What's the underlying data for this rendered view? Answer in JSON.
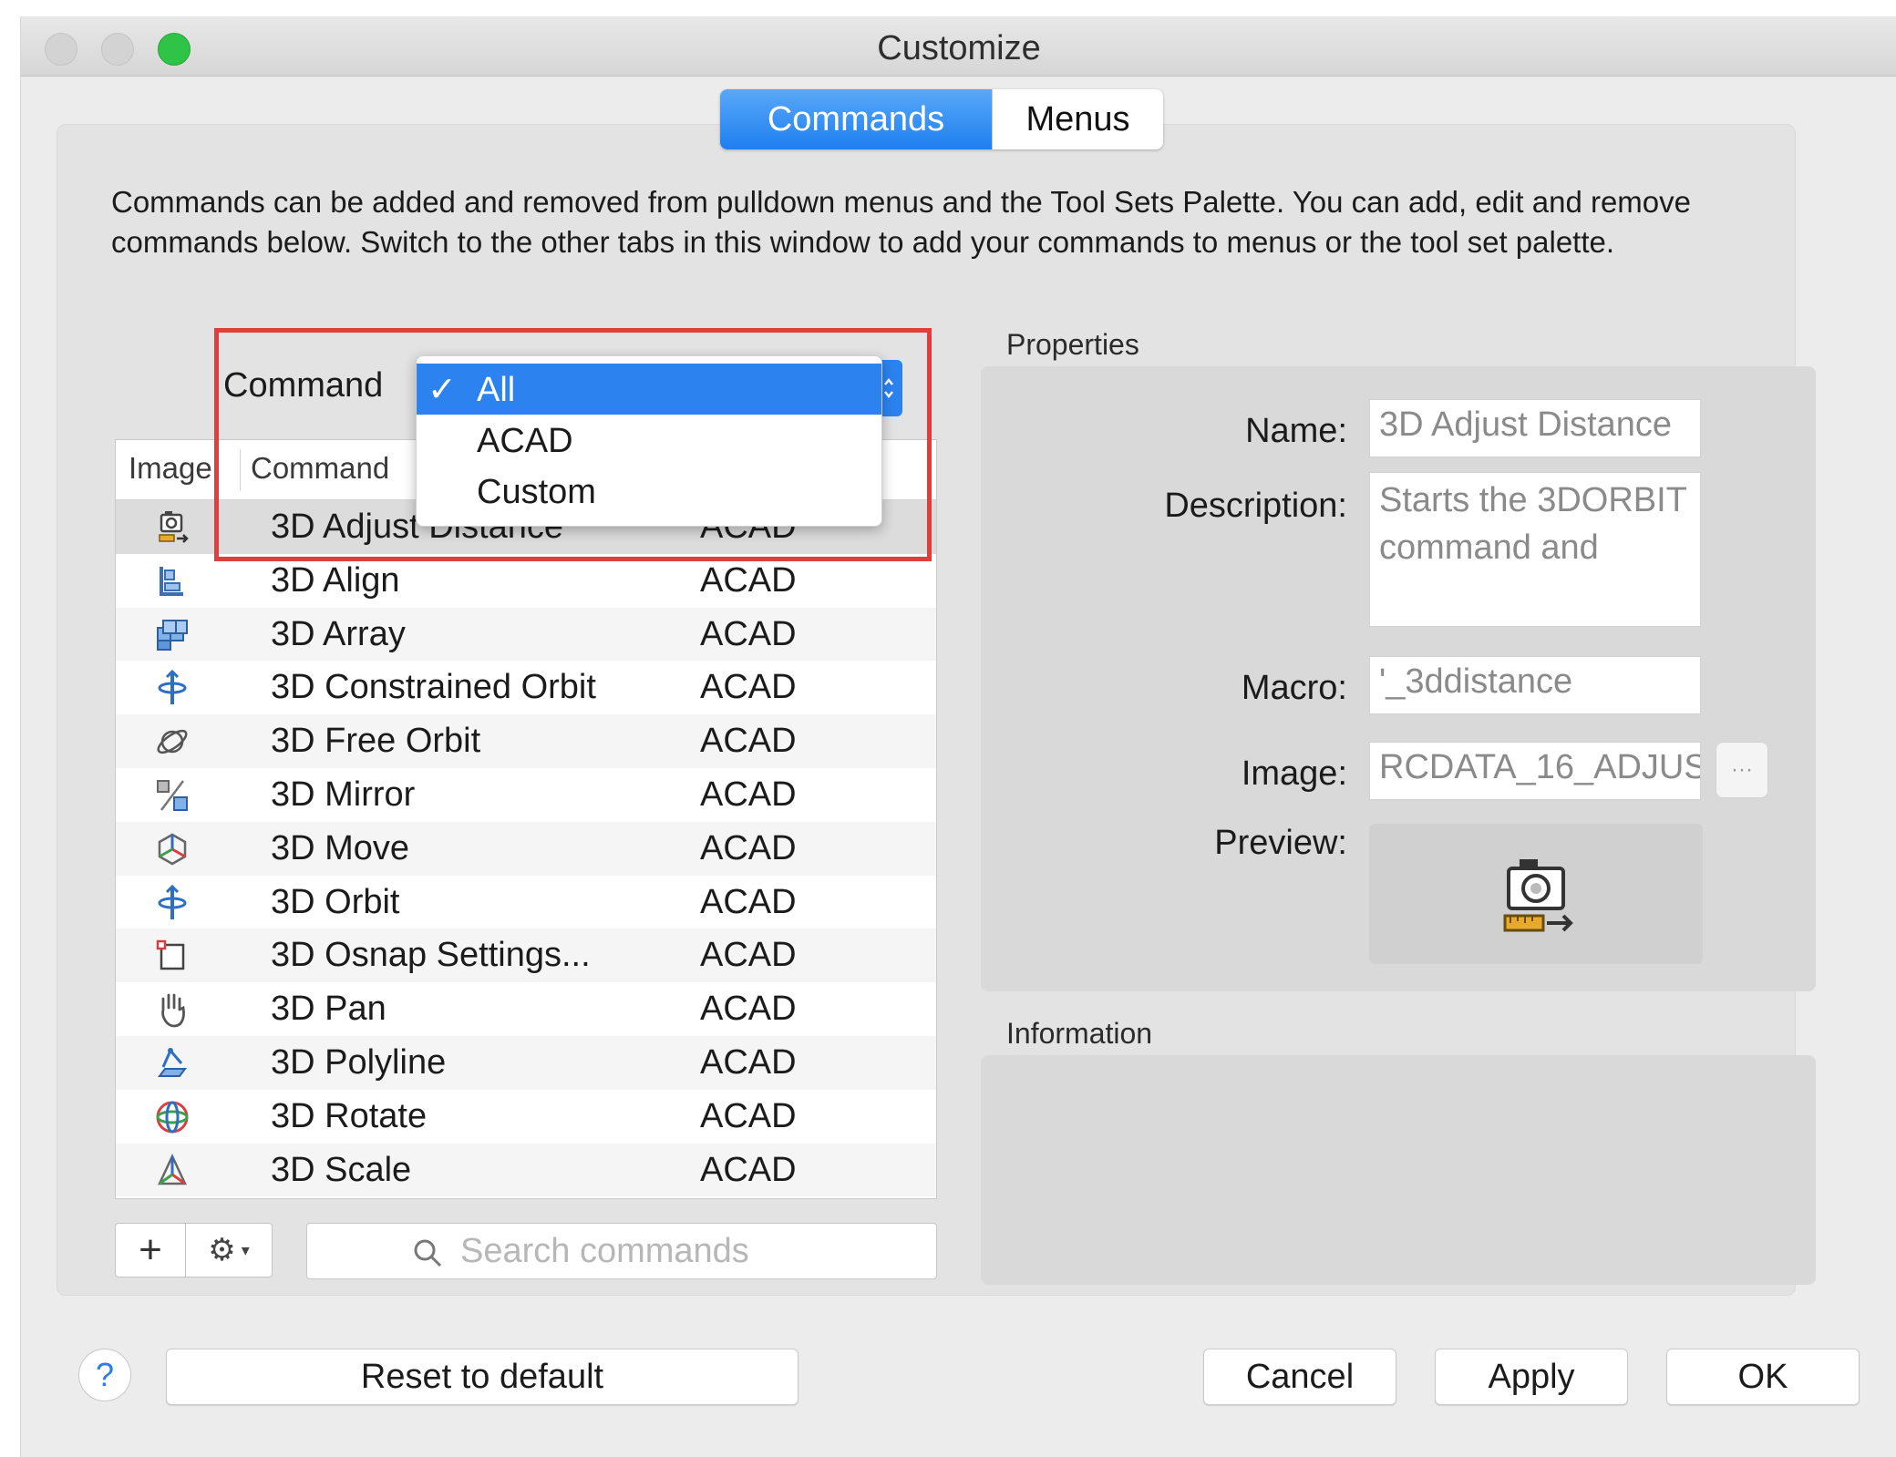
{
  "window": {
    "title": "Customize"
  },
  "tabs": [
    {
      "label": "Commands",
      "selected": true
    },
    {
      "label": "Menus",
      "selected": false
    }
  ],
  "intro_text": "Commands can be added and removed from pulldown menus and the Tool Sets Palette. You can add, edit and remove commands below. Switch to the other tabs in this window to add your commands to menus or the tool set palette.",
  "filter": {
    "label": "Command",
    "options": [
      "All",
      "ACAD",
      "Custom"
    ],
    "selected": "All",
    "check_glyph": "✓"
  },
  "table": {
    "headers": {
      "image": "Image",
      "command": "Command"
    },
    "rows": [
      {
        "icon": "camera-measure-icon",
        "name": "3D Adjust Distance",
        "source": "ACAD",
        "selected": true
      },
      {
        "icon": "align-icon",
        "name": "3D Align",
        "source": "ACAD"
      },
      {
        "icon": "array-icon",
        "name": "3D Array",
        "source": "ACAD"
      },
      {
        "icon": "constrained-orbit-icon",
        "name": "3D Constrained Orbit",
        "source": "ACAD"
      },
      {
        "icon": "free-orbit-icon",
        "name": "3D Free Orbit",
        "source": "ACAD"
      },
      {
        "icon": "mirror-icon",
        "name": "3D Mirror",
        "source": "ACAD"
      },
      {
        "icon": "move-gizmo-icon",
        "name": "3D Move",
        "source": "ACAD"
      },
      {
        "icon": "orbit-icon",
        "name": "3D Orbit",
        "source": "ACAD"
      },
      {
        "icon": "osnap-icon",
        "name": "3D Osnap Settings...",
        "source": "ACAD"
      },
      {
        "icon": "pan-hand-icon",
        "name": "3D Pan",
        "source": "ACAD"
      },
      {
        "icon": "polyline-icon",
        "name": "3D Polyline",
        "source": "ACAD"
      },
      {
        "icon": "rotate-gizmo-icon",
        "name": "3D Rotate",
        "source": "ACAD"
      },
      {
        "icon": "scale-gizmo-icon",
        "name": "3D Scale",
        "source": "ACAD"
      }
    ]
  },
  "toolbar": {
    "add_glyph": "+",
    "gear_glyph": "⚙",
    "gear_arrow": "▾"
  },
  "search": {
    "placeholder": "Search commands",
    "value": ""
  },
  "properties": {
    "title": "Properties",
    "name_label": "Name:",
    "name_value": "3D Adjust Distance",
    "description_label": "Description:",
    "description_value": "Starts the 3DORBIT command and",
    "macro_label": "Macro:",
    "macro_value": "'_3ddistance",
    "image_label": "Image:",
    "image_value": "RCDATA_16_ADJUS",
    "browse_label": "···",
    "preview_label": "Preview:"
  },
  "information": {
    "title": "Information"
  },
  "footer": {
    "help": "?",
    "reset": "Reset to default",
    "cancel": "Cancel",
    "apply": "Apply",
    "ok": "OK"
  },
  "colors": {
    "accent": "#2c83f0",
    "highlight_border": "#e23d3d",
    "traffic_green": "#2fc447"
  }
}
